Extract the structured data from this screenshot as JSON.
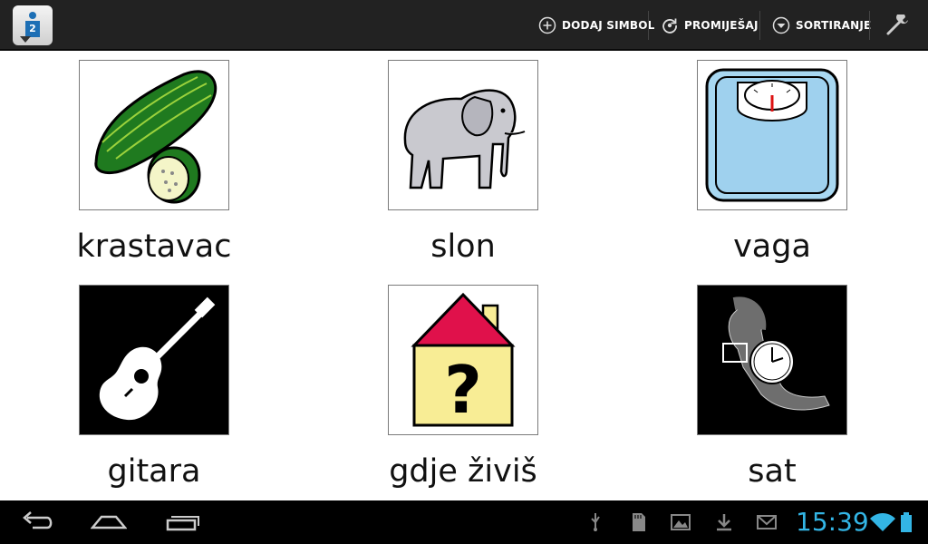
{
  "actionbar": {
    "app_icon_number": "2",
    "buttons": [
      {
        "label": "DODAJ SIMBOL",
        "icon": "add-circle-icon"
      },
      {
        "label": "PROMIJEŠAJ",
        "icon": "refresh-icon"
      },
      {
        "label": "SORTIRANJE",
        "icon": "sort-down-icon"
      }
    ],
    "settings_icon": "wrench-icon"
  },
  "symbols": [
    {
      "label": "krastavac",
      "image": "cucumber-image",
      "background": "#ffffff"
    },
    {
      "label": "slon",
      "image": "elephant-image",
      "background": "#ffffff"
    },
    {
      "label": "vaga",
      "image": "scale-image",
      "background": "#ffffff"
    },
    {
      "label": "gitara",
      "image": "guitar-image",
      "background": "#000000"
    },
    {
      "label": "gdje živiš",
      "image": "house-question-image",
      "background": "#ffffff"
    },
    {
      "label": "sat",
      "image": "watch-image",
      "background": "#000000"
    }
  ],
  "systembar": {
    "nav": [
      "back-icon",
      "home-icon",
      "recent-apps-icon"
    ],
    "status_icons": [
      "usb-icon",
      "sd-card-icon",
      "image-icon",
      "download-icon",
      "mail-icon"
    ],
    "clock": "15:39",
    "wifi": "wifi-icon",
    "battery": "battery-icon"
  },
  "colors": {
    "actionbar_bg": "#222222",
    "clock": "#33b5e5"
  }
}
